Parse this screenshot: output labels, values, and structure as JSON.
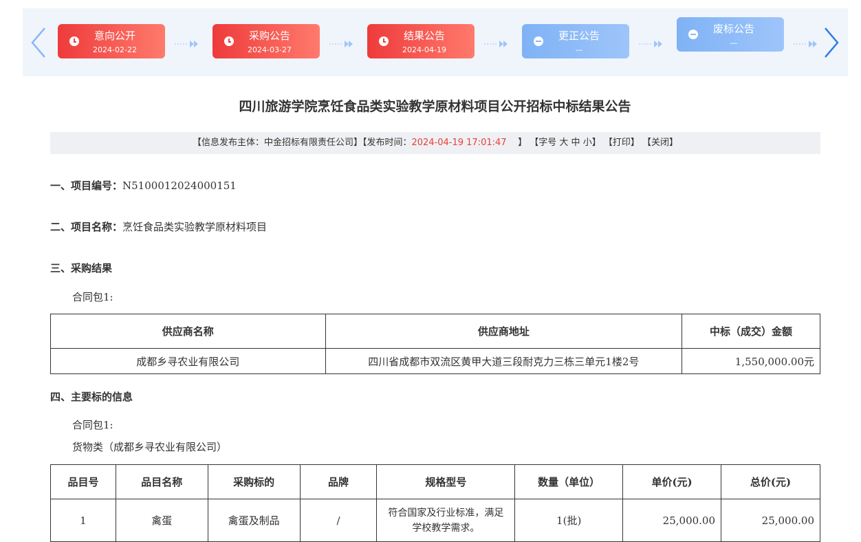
{
  "timeline": {
    "steps": [
      {
        "name": "意向公开",
        "date": "2024-02-22",
        "state": "active"
      },
      {
        "name": "采购公告",
        "date": "2024-03-27",
        "state": "active"
      },
      {
        "name": "结果公告",
        "date": "2024-04-19",
        "state": "active"
      },
      {
        "name": "更正公告",
        "date": "—",
        "state": "inactive"
      },
      {
        "name": "废标公告",
        "date": "—",
        "state": "inactive"
      }
    ],
    "colors": {
      "active": "#ee3b3b",
      "inactive": "#8ab8f5",
      "arrow": "#2f7fe8"
    }
  },
  "title": "四川旅游学院烹饪食品类实验教学原材料项目公开招标中标结果公告",
  "info": {
    "publisher_prefix": "【信息发布主体：中金招标有限责任公司】【发布时间：",
    "publish_time": "2024-04-19 17:01:47",
    "publish_suffix": "】",
    "font_label": "【字号",
    "font_large": "大",
    "font_medium": "中",
    "font_small": "小",
    "font_end": "】",
    "print": "【打印】",
    "close": "【关闭】"
  },
  "sections": {
    "s1_label": "一、项目编号：",
    "s1_value": "N5100012024000151",
    "s2_label": "二、项目名称：",
    "s2_value": "烹饪食品类实验教学原材料项目",
    "s3": "三、采购结果",
    "s3_package": "合同包1:",
    "s4": "四、主要标的信息",
    "s4_package": "合同包1:",
    "s4_category": "货物类（成都乡寻农业有限公司）"
  },
  "result_table": {
    "headers": [
      "供应商名称",
      "供应商地址",
      "中标（成交）金额"
    ],
    "rows": [
      [
        "成都乡寻农业有限公司",
        "四川省成都市双流区黄甲大道三段耐克力三栋三单元1楼2号",
        "1,550,000.00元"
      ]
    ]
  },
  "items_table": {
    "headers": [
      "品目号",
      "品目名称",
      "采购标的",
      "品牌",
      "规格型号",
      "数量（单位）",
      "单价(元)",
      "总价(元)"
    ],
    "rows": [
      [
        "1",
        "禽蛋",
        "禽蛋及制品",
        "/",
        "符合国家及行业标准，满足学校教学需求。",
        "1(批)",
        "25,000.00",
        "25,000.00"
      ]
    ]
  }
}
